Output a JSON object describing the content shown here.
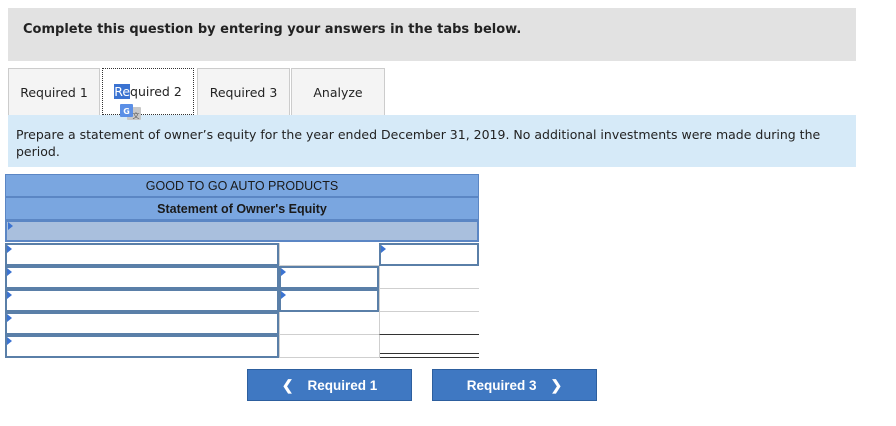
{
  "banner": {
    "text": "Complete this question by entering your answers in the tabs below."
  },
  "tabs": [
    {
      "label": "Required 1",
      "active": false
    },
    {
      "label_hl": "Re",
      "label_rest": "quired 2",
      "active": true
    },
    {
      "label": "Required 3",
      "active": false
    },
    {
      "label": "Analyze",
      "active": false
    }
  ],
  "instructions": "Prepare a statement of owner’s equity for the year ended December 31, 2019. No additional investments were made during the period.",
  "statement": {
    "company": "GOOD TO GO AUTO PRODUCTS",
    "title": "Statement of Owner's Equity"
  },
  "nav": {
    "prev_label": "Required 1",
    "prev_icon": "chevron-left-icon",
    "next_label": "Required 3",
    "next_icon": "chevron-right-icon"
  },
  "colors": {
    "header_blue": "#7aa6e0",
    "button_blue": "#3f78c2",
    "instruction_bg": "#d6eaf8"
  }
}
